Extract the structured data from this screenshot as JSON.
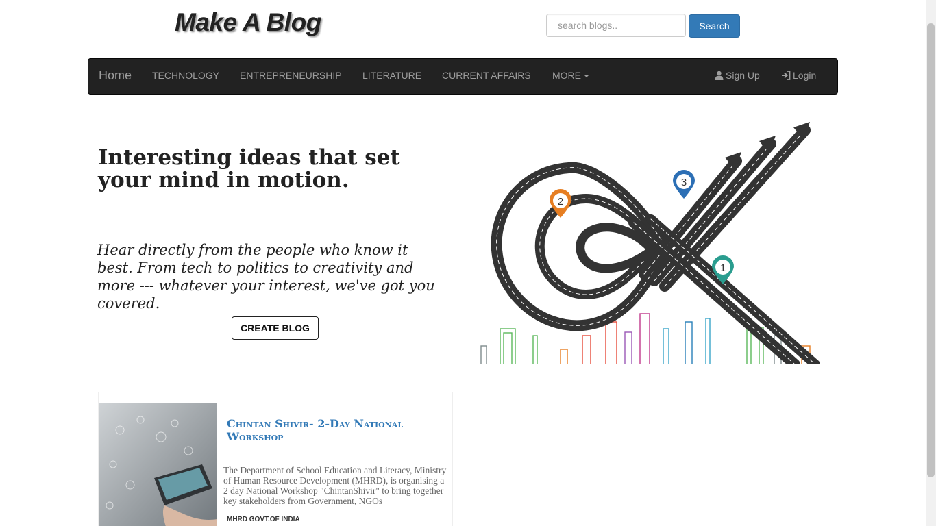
{
  "header": {
    "site_title": "Make A Blog",
    "search_placeholder": "search blogs..",
    "search_button": "Search"
  },
  "navbar": {
    "brand": "Home",
    "items": [
      {
        "label": "TECHNOLOGY"
      },
      {
        "label": "ENTREPRENEURSHIP"
      },
      {
        "label": "LITERATURE"
      },
      {
        "label": "CURRENT AFFAIRS"
      },
      {
        "label": "MORE"
      }
    ],
    "signup": "Sign Up",
    "login": "Login"
  },
  "hero": {
    "title": "Interesting ideas that set your mind in motion.",
    "subtitle": "Hear directly from the people who know it best. From tech to politics to creativity and more --- whatever your interest, we've got you covered.",
    "cta": "CREATE BLOG",
    "markers": [
      "1",
      "2",
      "3"
    ]
  },
  "blogs": [
    {
      "title": "Chintan Shivir- 2-Day National Workshop",
      "excerpt": "The Department of School Education and Literacy, Ministry of Human Resource Development (MHRD), is organising a 2 day National Workshop \"ChintanShivir\" to bring together key stakeholders from Government, NGOs",
      "author": "MHRD GOVT.OF INDIA"
    }
  ],
  "colors": {
    "navbar_bg": "#222222",
    "nav_text": "#9d9d9d",
    "primary": "#337ab7",
    "marker_orange": "#e67e22",
    "marker_blue": "#2c6fb5",
    "marker_teal": "#2a9d8f"
  }
}
